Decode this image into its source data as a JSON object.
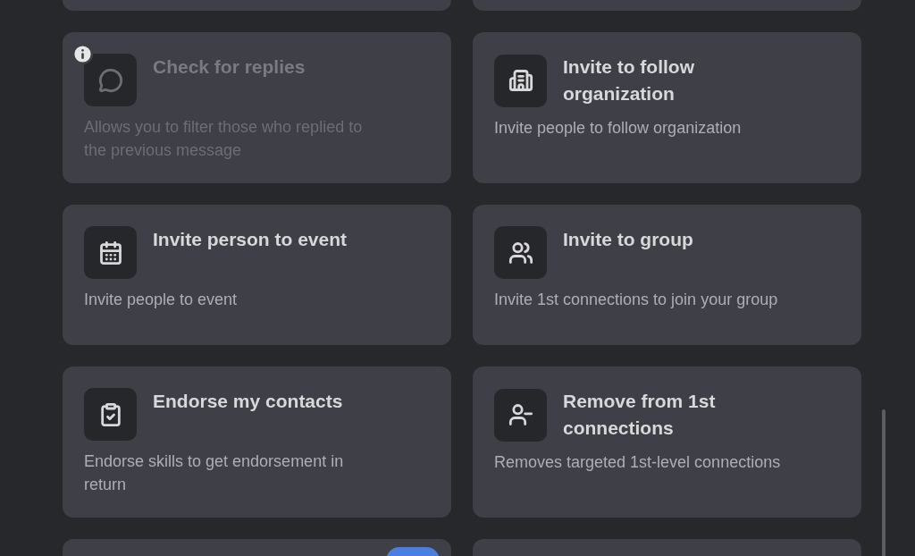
{
  "cards": [
    {
      "title": "Check for replies",
      "description": "Allows you to filter those who replied to the previous message",
      "disabled": true
    },
    {
      "title": "Invite to follow organization",
      "description": "Invite people to follow organization",
      "disabled": false
    },
    {
      "title": "Invite person to event",
      "description": "Invite people to event",
      "disabled": false
    },
    {
      "title": "Invite to group",
      "description": "Invite 1st connections to join your group",
      "disabled": false
    },
    {
      "title": "Endorse my contacts",
      "description": "Endorse skills to get endorsement in return",
      "disabled": false
    },
    {
      "title": "Remove from 1st connections",
      "description": "Removes targeted 1st-level connections",
      "disabled": false
    }
  ]
}
